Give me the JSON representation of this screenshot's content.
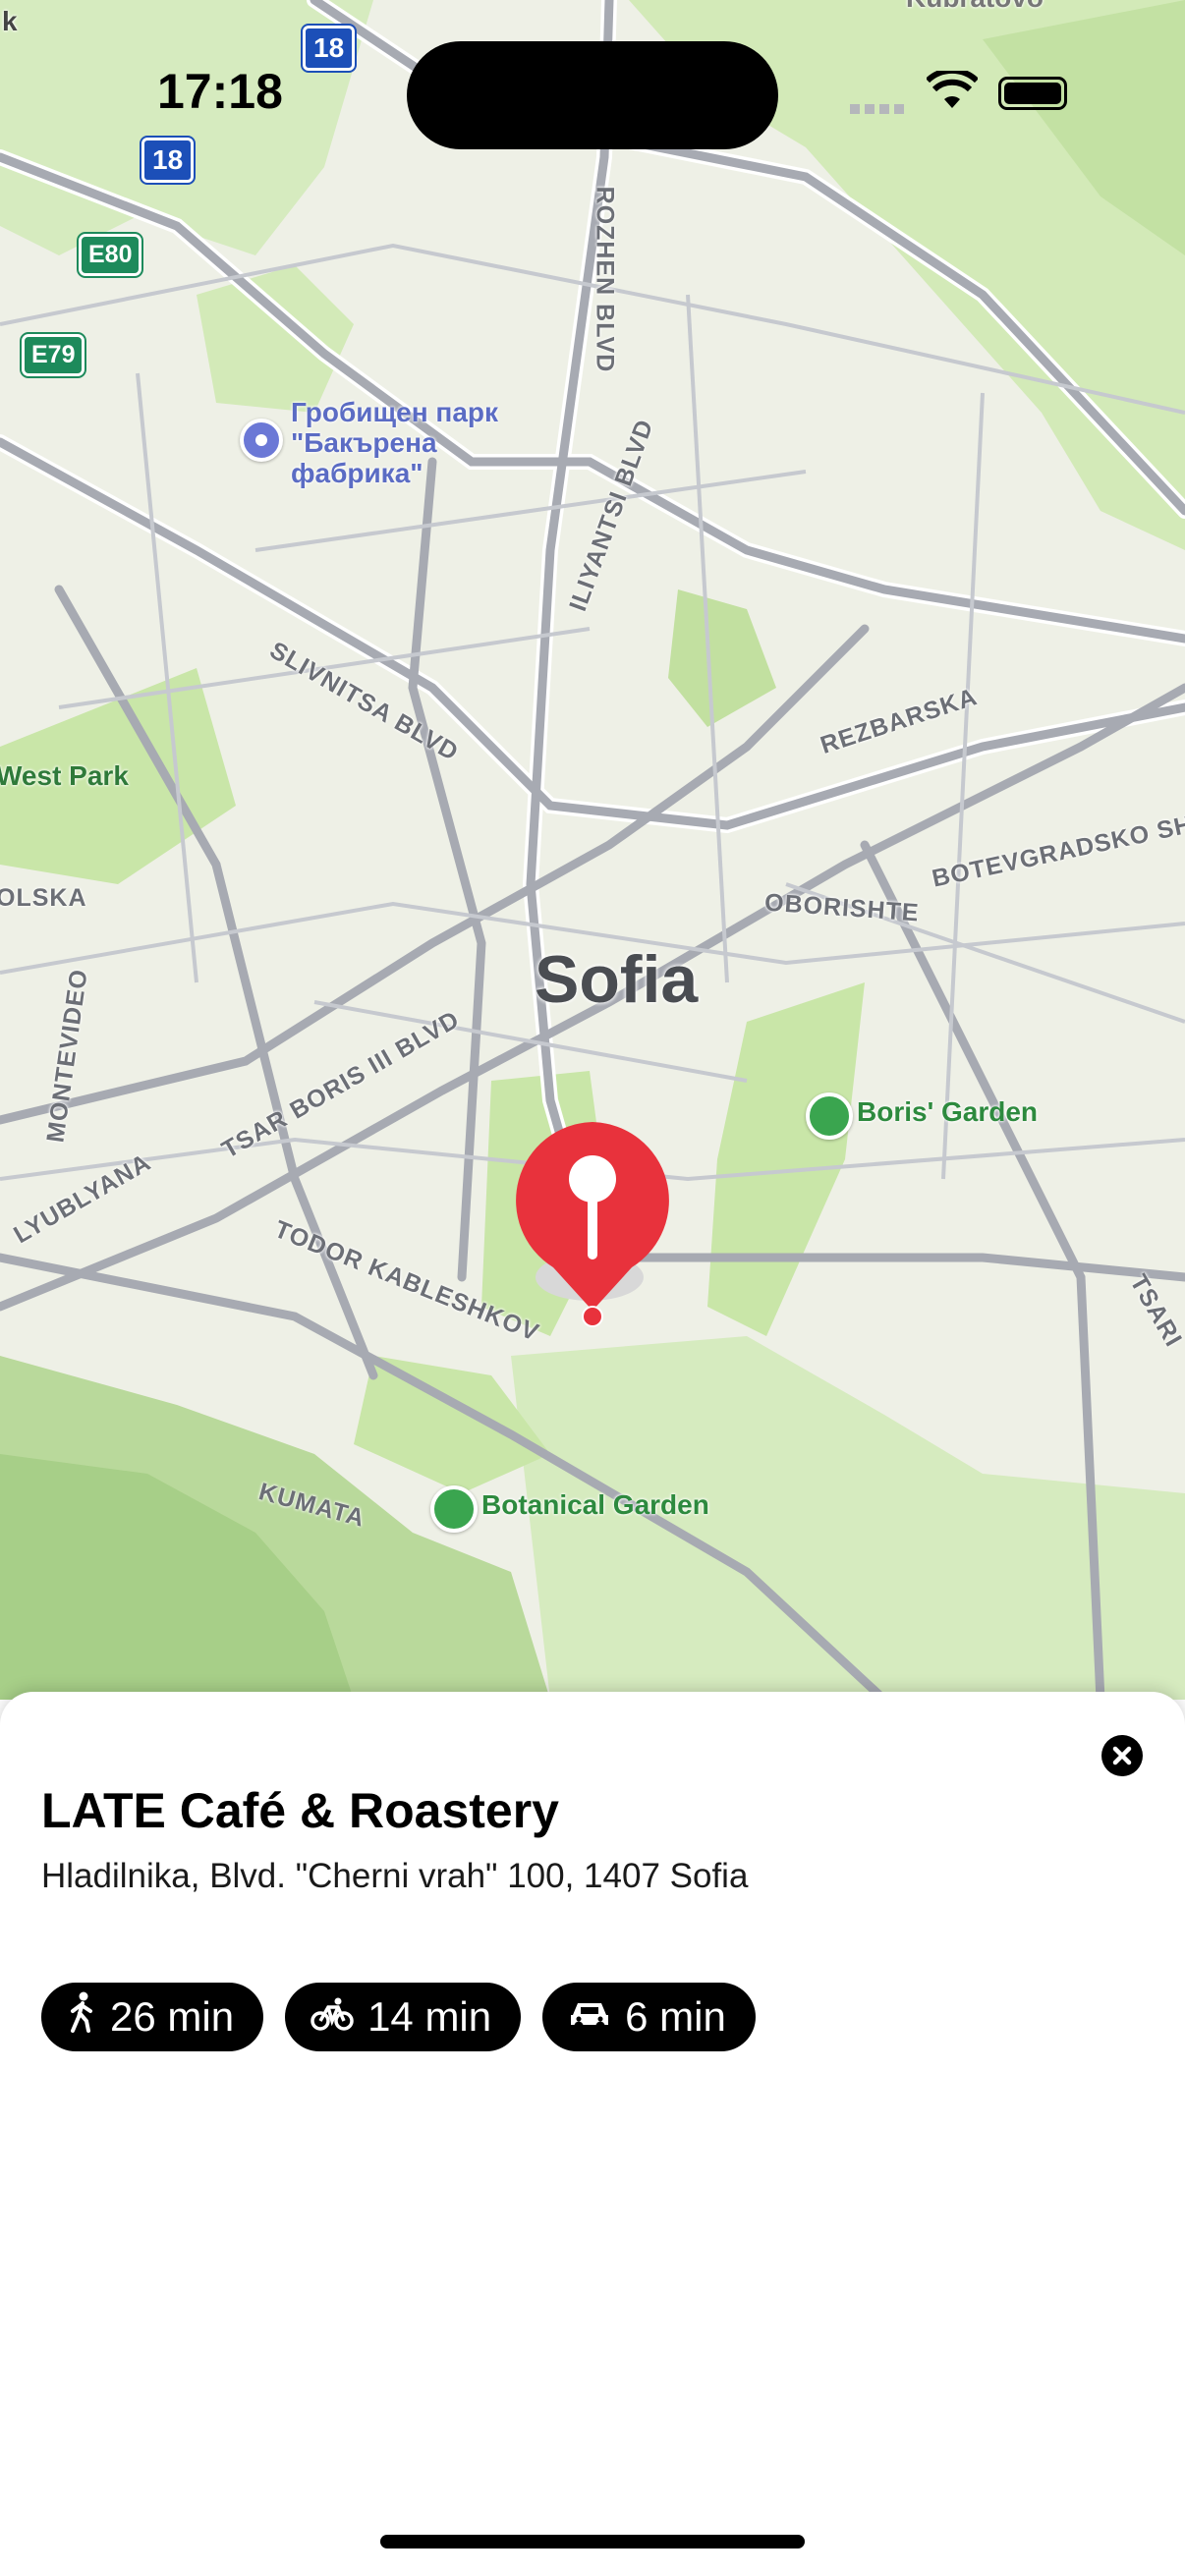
{
  "status_bar": {
    "time": "17:18"
  },
  "map": {
    "city": "Sofia",
    "road_labels": [
      "ROZHEN BLVD",
      "ILIYANTSI BLVD",
      "SLIVNITSA BLVD",
      "REZBARSKA",
      "BOTEVGRADSKO SH.",
      "OBORISHTE",
      "TSAR BORIS III BLVD",
      "MONTEVIDEO",
      "LYUBLYANA",
      "TODOR KABLESHKOV",
      "KUMATA",
      "TSARI",
      "OLSKA"
    ],
    "district_labels": [
      "West Park"
    ],
    "pois": {
      "boris_garden": "Boris' Garden",
      "botanical_garden": "Botanical Garden",
      "cemetery_line1": "Гробищен парк",
      "cemetery_line2": "\"Бакърена",
      "cemetery_line3": "фабрика\""
    },
    "shields": [
      "18",
      "18",
      "E80",
      "E79"
    ],
    "edge_labels": [
      "k",
      "Kubratovo"
    ]
  },
  "place": {
    "name": "LATE Café & Roastery",
    "address": "Hladilnika, Blvd. \"Cherni vrah\" 100, 1407 Sofia"
  },
  "travel_times": [
    {
      "mode": "walking",
      "icon": "walk-icon",
      "label": "26 min"
    },
    {
      "mode": "cycling",
      "icon": "bike-icon",
      "label": "14 min"
    },
    {
      "mode": "driving",
      "icon": "car-icon",
      "label": "6 min"
    }
  ],
  "colors": {
    "pin": "#e8323c",
    "park": "#c9e6a8",
    "road": "#a7aab2",
    "sheet": "#ffffff"
  }
}
